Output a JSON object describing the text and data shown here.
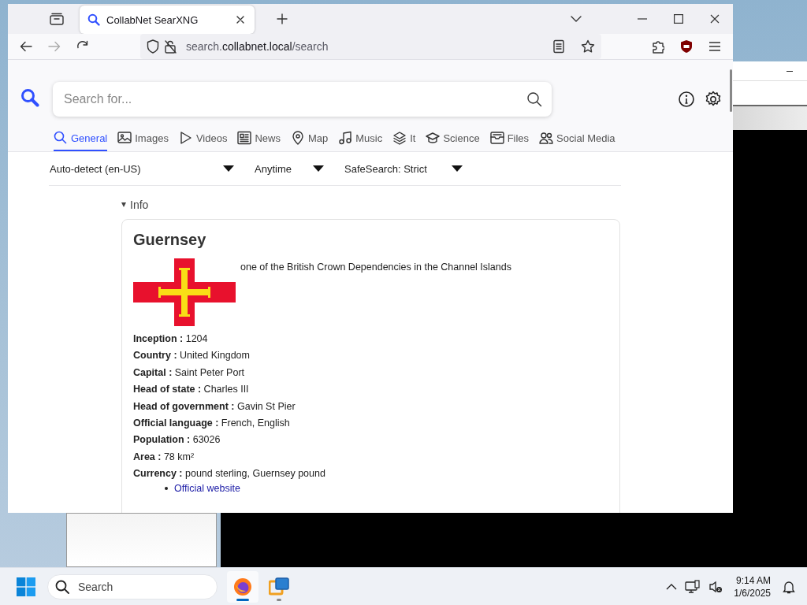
{
  "browser": {
    "tab": {
      "title": "CollabNet SearXNG",
      "selected": true
    },
    "url": {
      "prefix": "search.",
      "domain": "collabnet.local",
      "path": "/search"
    }
  },
  "search": {
    "placeholder": "Search for..."
  },
  "categories": [
    {
      "label": "General",
      "selected": true
    },
    {
      "label": "Images",
      "selected": false
    },
    {
      "label": "Videos",
      "selected": false
    },
    {
      "label": "News",
      "selected": false
    },
    {
      "label": "Map",
      "selected": false
    },
    {
      "label": "Music",
      "selected": false
    },
    {
      "label": "It",
      "selected": false
    },
    {
      "label": "Science",
      "selected": false
    },
    {
      "label": "Files",
      "selected": false
    },
    {
      "label": "Social Media",
      "selected": false
    }
  ],
  "filters": [
    {
      "label": "Auto-detect (en-US)"
    },
    {
      "label": "Anytime"
    },
    {
      "label": "SafeSearch: Strict"
    }
  ],
  "info_toggle": {
    "label": "Info",
    "expanded": true
  },
  "infobox": {
    "title": "Guernsey",
    "description": "one of the British Crown Dependencies in the Channel Islands",
    "attributes": [
      {
        "label": "Inception :",
        "value": "1204"
      },
      {
        "label": "Country :",
        "value": "United Kingdom"
      },
      {
        "label": "Capital :",
        "value": "Saint Peter Port"
      },
      {
        "label": "Head of state :",
        "value": "Charles III"
      },
      {
        "label": "Head of government :",
        "value": "Gavin St Pier"
      },
      {
        "label": "Official language :",
        "value": "French, English"
      },
      {
        "label": "Population :",
        "value": "63026"
      },
      {
        "label": "Area :",
        "value": "78 km²"
      },
      {
        "label": "Currency :",
        "value": "pound sterling, Guernsey pound"
      }
    ],
    "links": [
      "Official website"
    ]
  },
  "taskbar": {
    "search_placeholder": "Search",
    "time": "9:14 AM",
    "date": "1/6/2025"
  }
}
